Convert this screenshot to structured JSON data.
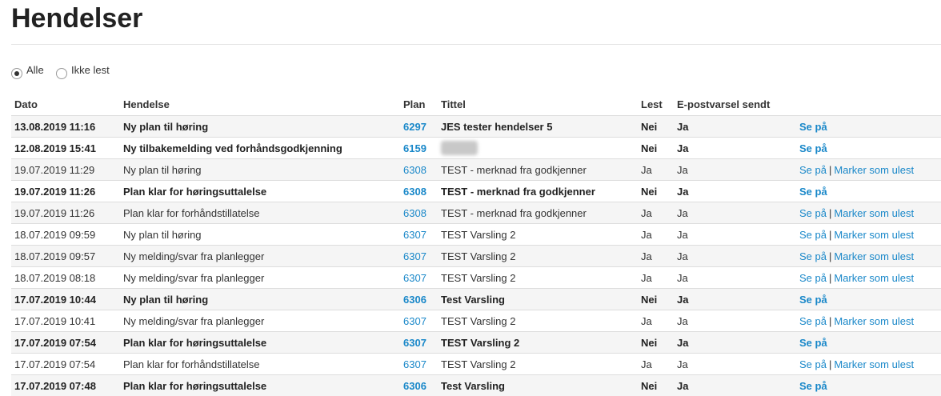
{
  "page": {
    "title": "Hendelser"
  },
  "filter": {
    "options": [
      {
        "label": "Alle",
        "selected": true
      },
      {
        "label": "Ikke lest",
        "selected": false
      }
    ]
  },
  "table": {
    "headers": {
      "dato": "Dato",
      "hendelse": "Hendelse",
      "plan": "Plan",
      "tittel": "Tittel",
      "lest": "Lest",
      "epost": "E-postvarsel sendt"
    },
    "action_labels": {
      "view": "Se på",
      "separator": "|",
      "mark_unread": "Marker som ulest"
    },
    "rows": [
      {
        "dato": "13.08.2019 11:16",
        "hendelse": "Ny plan til høring",
        "plan": "6297",
        "tittel": "JES tester hendelser 5",
        "lest": "Nei",
        "epost": "Ja",
        "unread": true,
        "redacted": false
      },
      {
        "dato": "12.08.2019 15:41",
        "hendelse": "Ny tilbakemelding ved forhåndsgodkjenning",
        "plan": "6159",
        "tittel": "",
        "lest": "Nei",
        "epost": "Ja",
        "unread": true,
        "redacted": true
      },
      {
        "dato": "19.07.2019 11:29",
        "hendelse": "Ny plan til høring",
        "plan": "6308",
        "tittel": "TEST - merknad fra godkjenner",
        "lest": "Ja",
        "epost": "Ja",
        "unread": false,
        "redacted": false
      },
      {
        "dato": "19.07.2019 11:26",
        "hendelse": "Plan klar for høringsuttalelse",
        "plan": "6308",
        "tittel": "TEST - merknad fra godkjenner",
        "lest": "Nei",
        "epost": "Ja",
        "unread": true,
        "redacted": false
      },
      {
        "dato": "19.07.2019 11:26",
        "hendelse": "Plan klar for forhåndstillatelse",
        "plan": "6308",
        "tittel": "TEST - merknad fra godkjenner",
        "lest": "Ja",
        "epost": "Ja",
        "unread": false,
        "redacted": false
      },
      {
        "dato": "18.07.2019 09:59",
        "hendelse": "Ny plan til høring",
        "plan": "6307",
        "tittel": "TEST Varsling 2",
        "lest": "Ja",
        "epost": "Ja",
        "unread": false,
        "redacted": false
      },
      {
        "dato": "18.07.2019 09:57",
        "hendelse": "Ny melding/svar fra planlegger",
        "plan": "6307",
        "tittel": "TEST Varsling 2",
        "lest": "Ja",
        "epost": "Ja",
        "unread": false,
        "redacted": false
      },
      {
        "dato": "18.07.2019 08:18",
        "hendelse": "Ny melding/svar fra planlegger",
        "plan": "6307",
        "tittel": "TEST Varsling 2",
        "lest": "Ja",
        "epost": "Ja",
        "unread": false,
        "redacted": false
      },
      {
        "dato": "17.07.2019 10:44",
        "hendelse": "Ny plan til høring",
        "plan": "6306",
        "tittel": "Test Varsling",
        "lest": "Nei",
        "epost": "Ja",
        "unread": true,
        "redacted": false
      },
      {
        "dato": "17.07.2019 10:41",
        "hendelse": "Ny melding/svar fra planlegger",
        "plan": "6307",
        "tittel": "TEST Varsling 2",
        "lest": "Ja",
        "epost": "Ja",
        "unread": false,
        "redacted": false
      },
      {
        "dato": "17.07.2019 07:54",
        "hendelse": "Plan klar for høringsuttalelse",
        "plan": "6307",
        "tittel": "TEST Varsling 2",
        "lest": "Nei",
        "epost": "Ja",
        "unread": true,
        "redacted": false
      },
      {
        "dato": "17.07.2019 07:54",
        "hendelse": "Plan klar for forhåndstillatelse",
        "plan": "6307",
        "tittel": "TEST Varsling 2",
        "lest": "Ja",
        "epost": "Ja",
        "unread": false,
        "redacted": false
      },
      {
        "dato": "17.07.2019 07:48",
        "hendelse": "Plan klar for høringsuttalelse",
        "plan": "6306",
        "tittel": "Test Varsling",
        "lest": "Nei",
        "epost": "Ja",
        "unread": true,
        "redacted": false
      }
    ]
  }
}
